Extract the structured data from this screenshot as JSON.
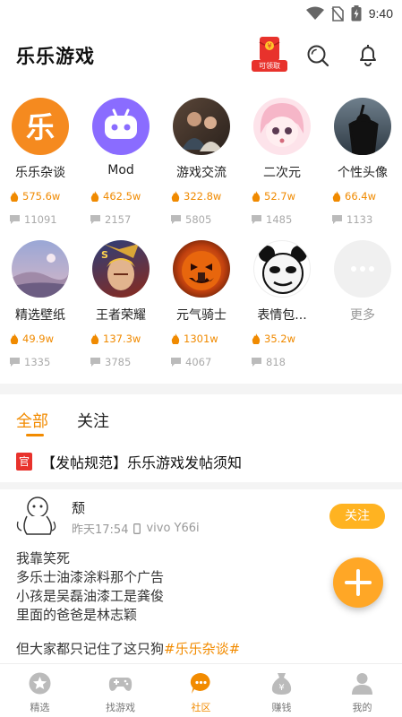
{
  "status_bar": {
    "time": "9:40"
  },
  "header": {
    "title": "乐乐游戏",
    "gift_badge": "可领取"
  },
  "categories": [
    {
      "name": "乐乐杂谈",
      "hot": "575.6w",
      "posts": "11091"
    },
    {
      "name": "Mod",
      "hot": "462.5w",
      "posts": "2157"
    },
    {
      "name": "游戏交流",
      "hot": "322.8w",
      "posts": "5805"
    },
    {
      "name": "二次元",
      "hot": "52.7w",
      "posts": "1485"
    },
    {
      "name": "个性头像",
      "hot": "66.4w",
      "posts": "1133"
    },
    {
      "name": "精选壁纸",
      "hot": "49.9w",
      "posts": "1335"
    },
    {
      "name": "王者荣耀",
      "hot": "137.3w",
      "posts": "3785"
    },
    {
      "name": "元气骑士",
      "hot": "1301w",
      "posts": "4067"
    },
    {
      "name": "表情包...",
      "hot": "35.2w",
      "posts": "818"
    },
    {
      "name": "更多"
    }
  ],
  "category_icon_text": {
    "lele": "乐",
    "ks": "S"
  },
  "tabs": {
    "all": "全部",
    "follow": "关注"
  },
  "notice": {
    "badge": "官",
    "text": "【发帖规范】乐乐游戏发帖须知"
  },
  "post": {
    "author": "颓",
    "time": "昨天17:54",
    "device": "vivo Y66i",
    "follow_label": "关注",
    "lines": [
      "我靠笑死",
      "多乐士油漆涂料那个广告",
      "小孩是吴磊油漆工是龚俊",
      "里面的爸爸是林志颖"
    ],
    "last_line_prefix": "但大家都只记住了这只狗",
    "last_line_tag": "#乐乐杂谈#"
  },
  "bottom_nav": [
    {
      "label": "精选",
      "icon": "star-icon"
    },
    {
      "label": "找游戏",
      "icon": "gamepad-icon"
    },
    {
      "label": "社区",
      "icon": "chat-bubble-icon",
      "active": true
    },
    {
      "label": "赚钱",
      "icon": "money-bag-icon"
    },
    {
      "label": "我的",
      "icon": "person-icon"
    }
  ],
  "colors": {
    "accent": "#f28b00",
    "follow_button": "#ffb321",
    "fab": "#ffa726",
    "official_badge": "#e8322c"
  }
}
